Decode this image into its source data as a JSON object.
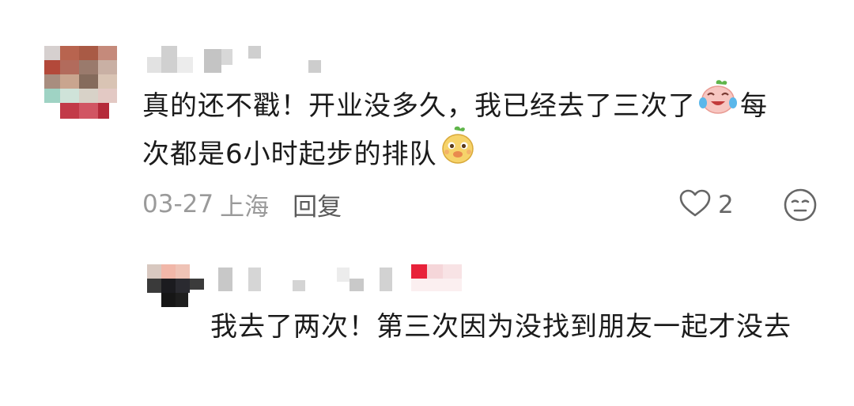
{
  "comment_1": {
    "avatar": "pixelated-avatar",
    "username": "",
    "text_line1": "真的还不戳！开业没多久，我已经去了三次了",
    "text_line1_tail": "每",
    "text_line2": "次都是6小时起步的排队",
    "emoji_1": "crying-laughing-peach-icon",
    "emoji_2": "yellow-bean-face-icon",
    "date": "03-27",
    "location": "上海",
    "reply_label": "回复",
    "like_count": "2",
    "like_icon": "heart-outline-icon",
    "react_icon": "neutral-face-icon"
  },
  "comment_2": {
    "avatar": "pixelated-avatar",
    "username": "",
    "text": "我去了两次！第三次因为没找到朋友一起才没去"
  },
  "colors": {
    "text": "#1b1b1b",
    "meta": "#9a9a9a",
    "reply": "#5a5a5a",
    "accent_red": "#e8223a"
  }
}
